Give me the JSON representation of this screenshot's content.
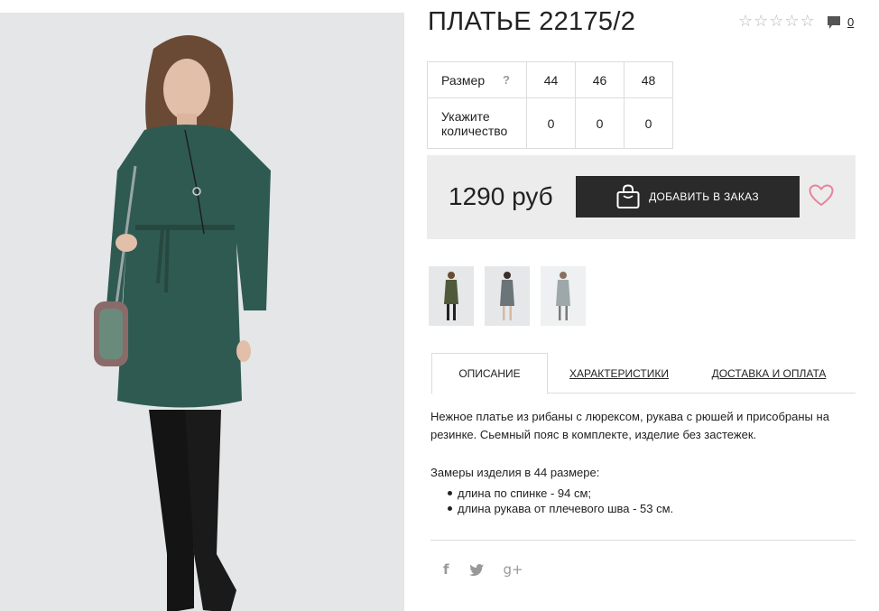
{
  "product": {
    "title": "ПЛАТЬЕ 22175/2",
    "image_icon": "product-photo-dress",
    "rating": {
      "stars": 5,
      "filled": 0,
      "star_glyph": "☆"
    },
    "comments_count": "0"
  },
  "sizes": {
    "row1_label": "Размер",
    "help": "?",
    "columns": [
      "44",
      "46",
      "48"
    ],
    "row2_label_line1": "Укажите",
    "row2_label_line2": "количество",
    "quantities": [
      "0",
      "0",
      "0"
    ]
  },
  "purchase": {
    "price": "1290 руб",
    "add_button": "ДОБАВИТЬ В ЗАКАЗ",
    "bag_icon": "shopping-bag-icon",
    "heart_icon": "heart-icon",
    "accent_color": "#e6849a"
  },
  "thumbnails": [
    {
      "icon": "thumb-dress-green"
    },
    {
      "icon": "thumb-dress-grey"
    },
    {
      "icon": "thumb-dress-light"
    }
  ],
  "tabs": [
    {
      "label": "ОПИСАНИЕ",
      "active": true
    },
    {
      "label": "ХАРАКТЕРИСТИКИ",
      "active": false
    },
    {
      "label": "ДОСТАВКА И ОПЛАТА",
      "active": false
    }
  ],
  "description": {
    "text": "Нежное платье из рибаны с люрексом, рукава с рюшей и присобраны на резинке. Сьемный пояс в комплекте, изделие без застежек.",
    "measure_title": "Замеры изделия в 44 размере:",
    "measures": [
      "длина по спинке - 94 см;",
      "длина рукава от плечевого шва - 53 см."
    ]
  },
  "social": {
    "facebook": "f",
    "twitter": "🐦",
    "google_plus": "g+"
  }
}
